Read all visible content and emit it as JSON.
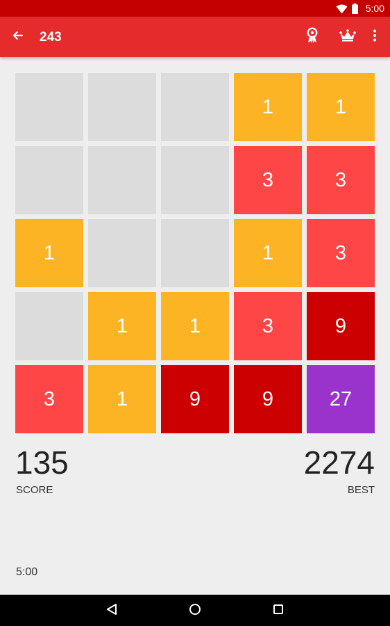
{
  "status_bar": {
    "time": "5:00",
    "icons": [
      "wifi-icon",
      "battery-icon"
    ]
  },
  "app_bar": {
    "title": "243",
    "back_icon": "arrow-back-icon",
    "actions": [
      "award-ribbon-icon",
      "crown-icon",
      "more-vert-icon"
    ]
  },
  "board": {
    "rows": 5,
    "cols": 5,
    "tiles": [
      [
        "",
        "",
        "",
        "1",
        "1"
      ],
      [
        "",
        "",
        "",
        "3",
        "3"
      ],
      [
        "1",
        "",
        "",
        "1",
        "3"
      ],
      [
        "",
        "1",
        "1",
        "3",
        "9"
      ],
      [
        "3",
        "1",
        "9",
        "9",
        "27"
      ]
    ],
    "colors": {
      "empty": "#dcdcdc",
      "1": "#fdb424",
      "3": "#ff4646",
      "9": "#cc0000",
      "27": "#9933cc"
    }
  },
  "score": {
    "value": "135",
    "label": "SCORE"
  },
  "best": {
    "value": "2274",
    "label": "BEST"
  },
  "timer": "5:00",
  "nav": [
    "nav-back-icon",
    "nav-home-icon",
    "nav-recent-icon"
  ],
  "theme": {
    "app_bar": "#e52b2b",
    "status_bar": "#c40000",
    "background": "#eeeeee"
  }
}
